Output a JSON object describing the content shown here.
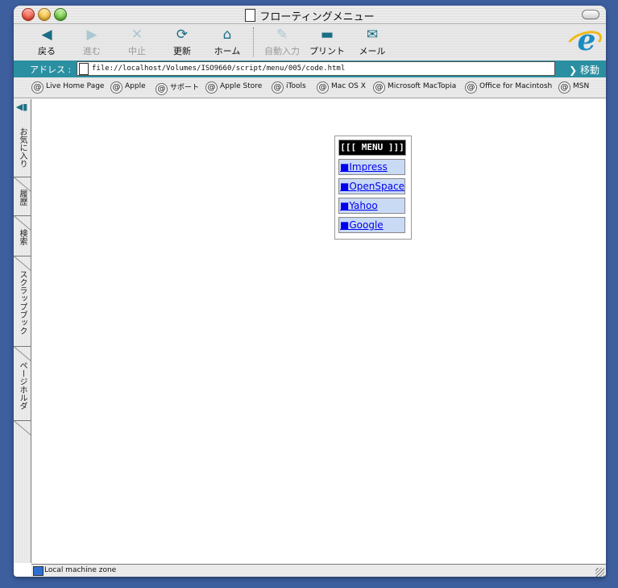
{
  "window": {
    "title": "フローティングメニュー"
  },
  "toolbar": {
    "back": "戻る",
    "forward": "進む",
    "stop": "中止",
    "refresh": "更新",
    "home": "ホーム",
    "autofill": "自動入力",
    "print": "プリント",
    "mail": "メール"
  },
  "address": {
    "label": "アドレス :",
    "url": "file://localhost/Volumes/ISO9660/script/menu/005/code.html",
    "go": "移動"
  },
  "favorites": [
    "Live Home Page",
    "Apple",
    "サポート",
    "Apple Store",
    "iTools",
    "Mac OS X",
    "Microsoft MacTopia",
    "Office for Macintosh",
    "MSN"
  ],
  "sidebar": {
    "tabs": [
      "お気に入り",
      "履歴",
      "検索",
      "スクラップブック",
      "ページホルダ"
    ]
  },
  "menu": {
    "title": "[[[ MENU ]]]",
    "items": [
      "■Impress",
      "■OpenSpace",
      "■Yahoo",
      "■Google"
    ]
  },
  "status": {
    "zone": "Local machine zone"
  }
}
